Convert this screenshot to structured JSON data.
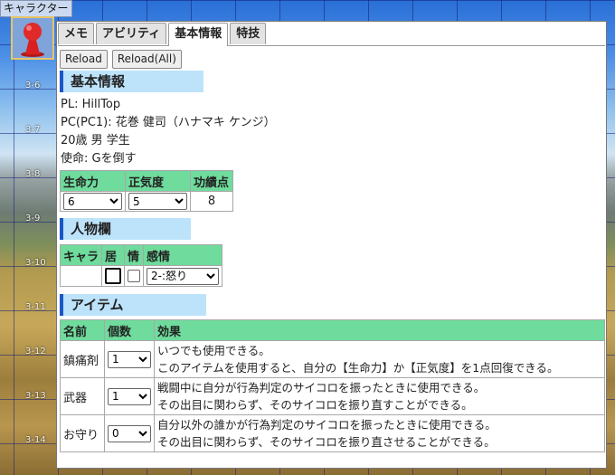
{
  "window": {
    "title": "キャラクター"
  },
  "map": {
    "row_labels": [
      "3-6",
      "3-7",
      "3-8",
      "3-9",
      "3-10",
      "3-11",
      "3-12",
      "3-13",
      "3-14"
    ]
  },
  "tabs": [
    {
      "label": "メモ"
    },
    {
      "label": "アビリティ"
    },
    {
      "label": "基本情報",
      "active": true
    },
    {
      "label": "特技"
    }
  ],
  "buttons": {
    "reload": "Reload",
    "reload_all": "Reload(All)"
  },
  "basic": {
    "heading": "基本情報",
    "pl": "PL: HillTop",
    "pc": "PC(PC1): 花巻 健司（ハナマキ ケンジ）",
    "profile": "20歳 男 学生",
    "mission": "使命: Gを倒す",
    "stats_headers": [
      "生命力",
      "正気度",
      "功績点"
    ],
    "life": "6",
    "sanity": "5",
    "merit": "8"
  },
  "people": {
    "heading": "人物欄",
    "headers": [
      "キャラ",
      "居",
      "情",
      "感情"
    ],
    "emotion": "2-:怒り"
  },
  "items": {
    "heading": "アイテム",
    "headers": [
      "名前",
      "個数",
      "効果"
    ],
    "rows": [
      {
        "name": "鎮痛剤",
        "count": "1",
        "effect1": "いつでも使用できる。",
        "effect2": "このアイテムを使用すると、自分の【生命力】か【正気度】を1点回復できる。"
      },
      {
        "name": "武器",
        "count": "1",
        "effect1": "戦闘中に自分が行為判定のサイコロを振ったときに使用できる。",
        "effect2": "その出目に関わらず、そのサイコロを振り直すことができる。"
      },
      {
        "name": "お守り",
        "count": "0",
        "effect1": "自分以外の誰かが行為判定のサイコロを振ったときに使用できる。",
        "effect2": "その出目に関わらず、そのサイコロを振り直させることができる。"
      }
    ]
  },
  "colors": {
    "header_green": "#6fdb9c",
    "section_blue": "#bde3fb",
    "accent": "#1a56c8"
  },
  "icons": {
    "avatar": "red-pawn-icon"
  }
}
